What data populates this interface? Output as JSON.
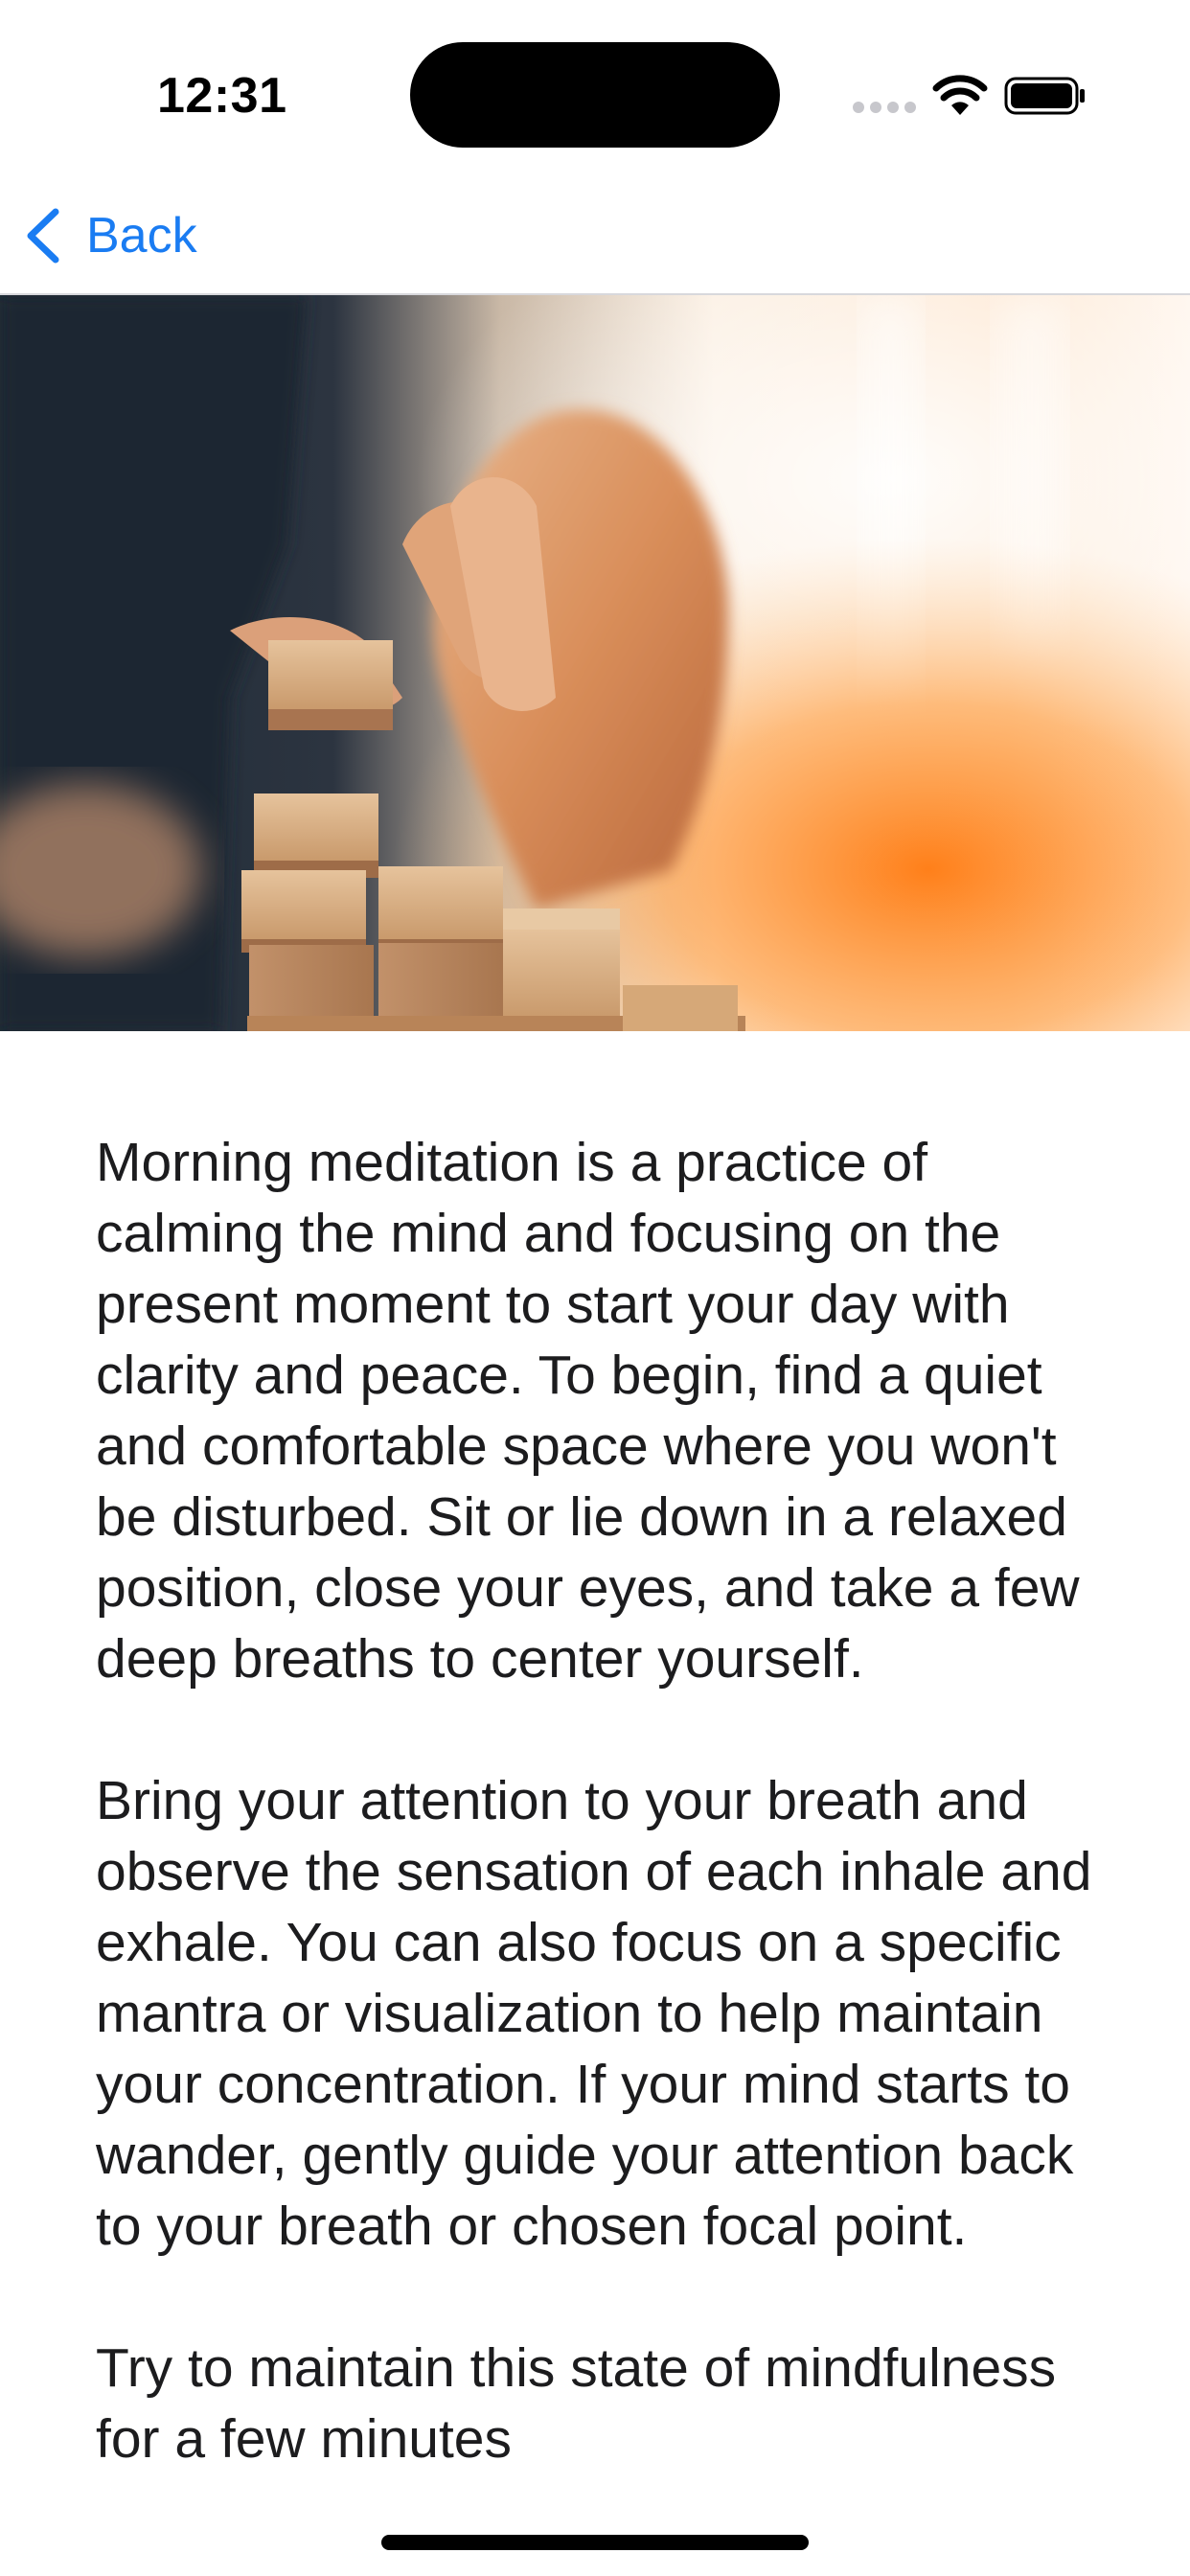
{
  "status_bar": {
    "time": "12:31"
  },
  "nav": {
    "back_label": "Back"
  },
  "hero": {
    "icon": "hero-image"
  },
  "article": {
    "paragraphs": [
      "Morning meditation is a practice of calming the mind and focusing on the present moment to start your day with clarity and peace. To begin, find a quiet and comfortable space where you won't be disturbed. Sit or lie down in a relaxed position, close your eyes, and take a few deep breaths to center yourself.",
      "Bring your attention to your breath and observe the sensation of each inhale and exhale. You can also focus on a specific mantra or visualization to help maintain your concentration. If your mind starts to wander, gently guide your attention back to your breath or chosen focal point.",
      "Try to maintain this state of mindfulness for a few minutes"
    ]
  },
  "colors": {
    "accent": "#1a7cf2",
    "text": "#1c1c1e",
    "background": "#ffffff"
  }
}
